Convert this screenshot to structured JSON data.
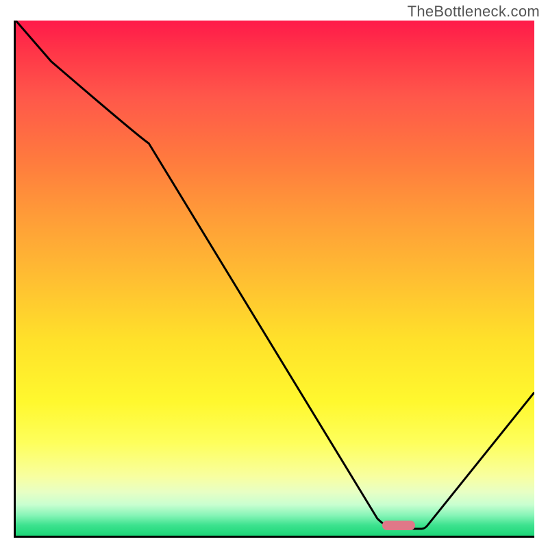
{
  "watermark": "TheBottleneck.com",
  "chart_data": {
    "type": "line",
    "title": "",
    "xlabel": "",
    "ylabel": "",
    "xlim": [
      0,
      100
    ],
    "ylim": [
      0,
      100
    ],
    "x": [
      0,
      7,
      25,
      70,
      74,
      78,
      100
    ],
    "values": [
      100,
      92,
      78,
      3,
      2,
      2,
      28
    ],
    "marker_position": {
      "x_pct": 73,
      "y_pct": 97.5
    },
    "background": "rainbow-gradient-red-to-green"
  }
}
